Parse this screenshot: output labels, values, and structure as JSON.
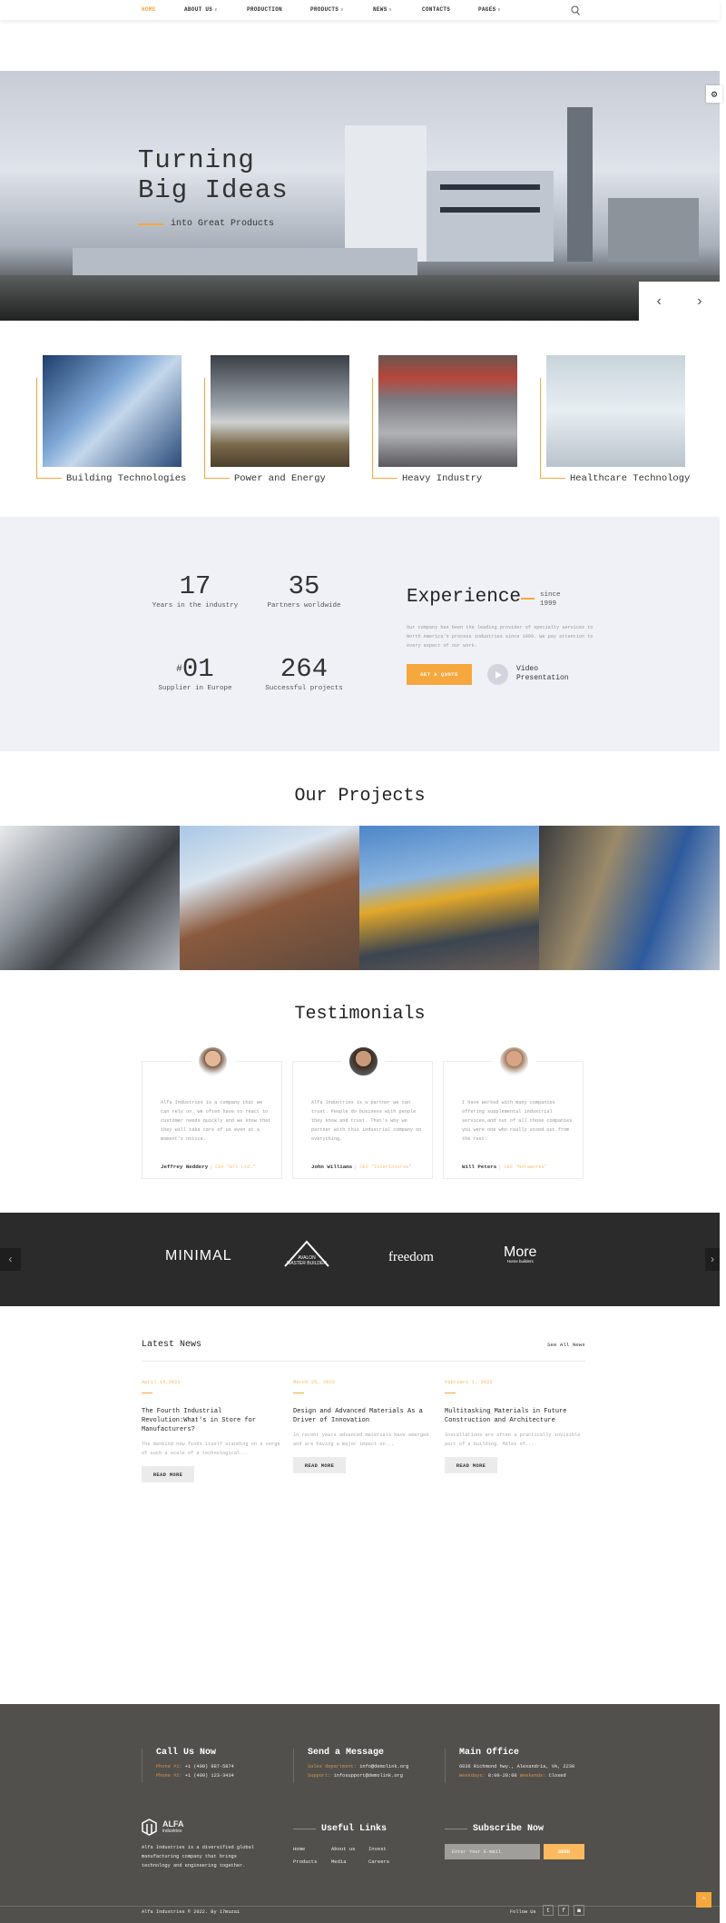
{
  "nav": {
    "items": [
      {
        "label": "HOME",
        "active": true,
        "dropdown": false
      },
      {
        "label": "ABOUT US",
        "dropdown": true
      },
      {
        "label": "PRODUCTION",
        "dropdown": false
      },
      {
        "label": "PRODUCTS",
        "dropdown": true
      },
      {
        "label": "NEWS",
        "dropdown": true
      },
      {
        "label": "CONTACTS",
        "dropdown": false
      },
      {
        "label": "PAGES",
        "dropdown": true
      }
    ],
    "search_icon": "search-icon"
  },
  "hero": {
    "title_line1": "Turning",
    "title_line2": "Big Ideas",
    "subtitle": "into Great Products",
    "prev": "‹",
    "next": "›",
    "settings_icon": "⚙"
  },
  "categories": [
    {
      "label": "Building Technologies"
    },
    {
      "label": "Power and Energy"
    },
    {
      "label": "Heavy Industry"
    },
    {
      "label": "Healthcare Technology"
    }
  ],
  "stats": [
    {
      "value": "17",
      "label": "Years in the industry"
    },
    {
      "value": "35",
      "label": "Partners worldwide"
    },
    {
      "prefix": "#",
      "value": "01",
      "label": "Supplier in Europe"
    },
    {
      "value": "264",
      "label": "Successful projects"
    }
  ],
  "experience": {
    "title": "Experience",
    "since": "since",
    "year": "1999",
    "text": "Our company has been the leading provider of specialty services to North America's process industries since 1999. We pay attention to every aspect of our work.",
    "quote_button": "GET A QUOTE",
    "video_label": "Video Presentation"
  },
  "projects": {
    "title": "Our Projects"
  },
  "testimonials": {
    "title": "Testimonials",
    "items": [
      {
        "text": "Alfa Industries is a company that we can rely on. We often have to react to customer needs quickly and we know that they will take care of us even at a moment's notice.",
        "name": "Jeffrey Neddery",
        "role": "CEO \"BTC Ltd.\""
      },
      {
        "text": "Alfa Industries is a partner we can trust. People do business with people they know and trust. That's why we partner with this industrial company on everything.",
        "name": "John Williams",
        "role": "CEO \"InterInverse\""
      },
      {
        "text": "I have worked with many companies offering supplemental industrial services,and out of all those companies you were one who really stood out from the rest.",
        "name": "Will Peters",
        "role": "CEO \"Netaworks\""
      }
    ]
  },
  "partners": {
    "logos": [
      "MINIMAL",
      "AVALON",
      "MASTER BUILDER",
      "freedom",
      "More",
      "Home builders"
    ],
    "prev": "‹",
    "next": "›"
  },
  "news": {
    "title": "Latest News",
    "see_all": "See All News",
    "items": [
      {
        "date": "April 13,2022",
        "title": "The Fourth Industrial Revolution:What's in Store for Manufacturers?",
        "excerpt": "The mankind now finds itself standing on a verge of such a scale of a technological...",
        "button": "READ MORE"
      },
      {
        "date": "March 25, 2022",
        "title": "Design and Advanced Materials As a Driver of Innovation",
        "excerpt": "In recent years advanced materials have emerged and are having a major impact on...",
        "button": "READ MORE"
      },
      {
        "date": "February 1, 2022",
        "title": "Multitasking Materials in Future Construction and Architecture",
        "excerpt": "Installations are often a practically invisible part of a building. Miles of...",
        "button": "READ MORE"
      }
    ]
  },
  "footer": {
    "call": {
      "title": "Call Us Now",
      "phone1_label": "Phone #1:",
      "phone1": "+1 (409) 987-5874",
      "phone2_label": "Phone #2:",
      "phone2": "+1 (409) 123-3434"
    },
    "message": {
      "title": "Send a Message",
      "sales_label": "Sales department:",
      "sales": "info@demolink.org",
      "support_label": "Support:",
      "support": "infosupport@demolink.org"
    },
    "office": {
      "title": "Main Office",
      "address": "6036 Richmond hwy., Alexandria, VA, 2230",
      "weekdays_label": "Weekdays:",
      "weekdays": "8:00-20:00",
      "weekends_label": "Weekends:",
      "weekends": "Closed"
    },
    "brand": {
      "name": "ALFA",
      "tagline": "industries",
      "description": "Alfa Industries is a diversified global manufacturing company that brings technology and engineering together."
    },
    "links": {
      "title": "Useful Links",
      "items": [
        "Home",
        "About us",
        "Invest",
        "Products",
        "Media",
        "Careers"
      ]
    },
    "subscribe": {
      "title": "Subscribe Now",
      "placeholder": "Enter Your E-mail",
      "button": "SEND"
    },
    "copyright": "Alfa Industries © 2022. By 17muzai",
    "follow": "Follow Us",
    "social": [
      "twitter-icon",
      "facebook-icon",
      "instagram-icon"
    ]
  },
  "colors": {
    "accent": "#f6a73e",
    "stats_bg": "#f0f1f6",
    "logos_bg": "#2b2b2b",
    "footer_bg": "#52504c"
  }
}
